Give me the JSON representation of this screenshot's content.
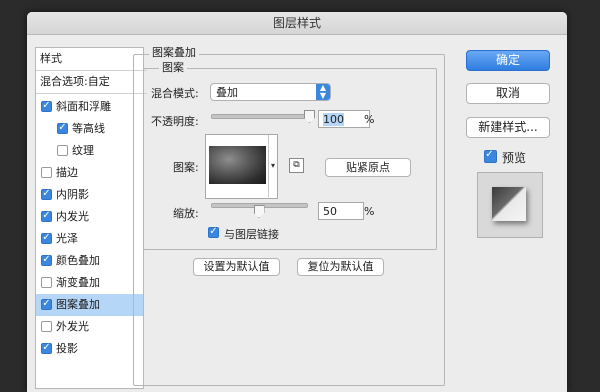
{
  "window": {
    "title": "图层样式"
  },
  "styles_list": {
    "header": "样式",
    "blend_options": "混合选项:自定",
    "items": [
      {
        "label": "斜面和浮雕",
        "checked": true,
        "indent": false,
        "selected": false
      },
      {
        "label": "等高线",
        "checked": true,
        "indent": true,
        "selected": false
      },
      {
        "label": "纹理",
        "checked": false,
        "indent": true,
        "selected": false
      },
      {
        "label": "描边",
        "checked": false,
        "indent": false,
        "selected": false
      },
      {
        "label": "内阴影",
        "checked": true,
        "indent": false,
        "selected": false
      },
      {
        "label": "内发光",
        "checked": true,
        "indent": false,
        "selected": false
      },
      {
        "label": "光泽",
        "checked": true,
        "indent": false,
        "selected": false
      },
      {
        "label": "颜色叠加",
        "checked": true,
        "indent": false,
        "selected": false
      },
      {
        "label": "渐变叠加",
        "checked": false,
        "indent": false,
        "selected": false
      },
      {
        "label": "图案叠加",
        "checked": true,
        "indent": false,
        "selected": true
      },
      {
        "label": "外发光",
        "checked": false,
        "indent": false,
        "selected": false
      },
      {
        "label": "投影",
        "checked": true,
        "indent": false,
        "selected": false
      }
    ]
  },
  "pattern_overlay": {
    "group_title": "图案叠加",
    "subgroup_title": "图案",
    "blend_mode_label": "混合模式:",
    "blend_mode_value": "叠加",
    "opacity_label": "不透明度:",
    "opacity_value": "100",
    "opacity_level": 1.0,
    "percent": "%",
    "pattern_label": "图案:",
    "snap_origin_button": "贴紧原点",
    "scale_label": "缩放:",
    "scale_value": "50",
    "scale_level": 0.5,
    "link_label": "与图层链接",
    "link_checked": true,
    "make_default_button": "设置为默认值",
    "reset_default_button": "复位为默认值"
  },
  "actions": {
    "ok": "确定",
    "cancel": "取消",
    "new_style": "新建样式...",
    "preview_label": "预览",
    "preview_checked": true
  },
  "colors": {
    "accent": "#3b87e0",
    "selection": "#b6d6f7"
  }
}
